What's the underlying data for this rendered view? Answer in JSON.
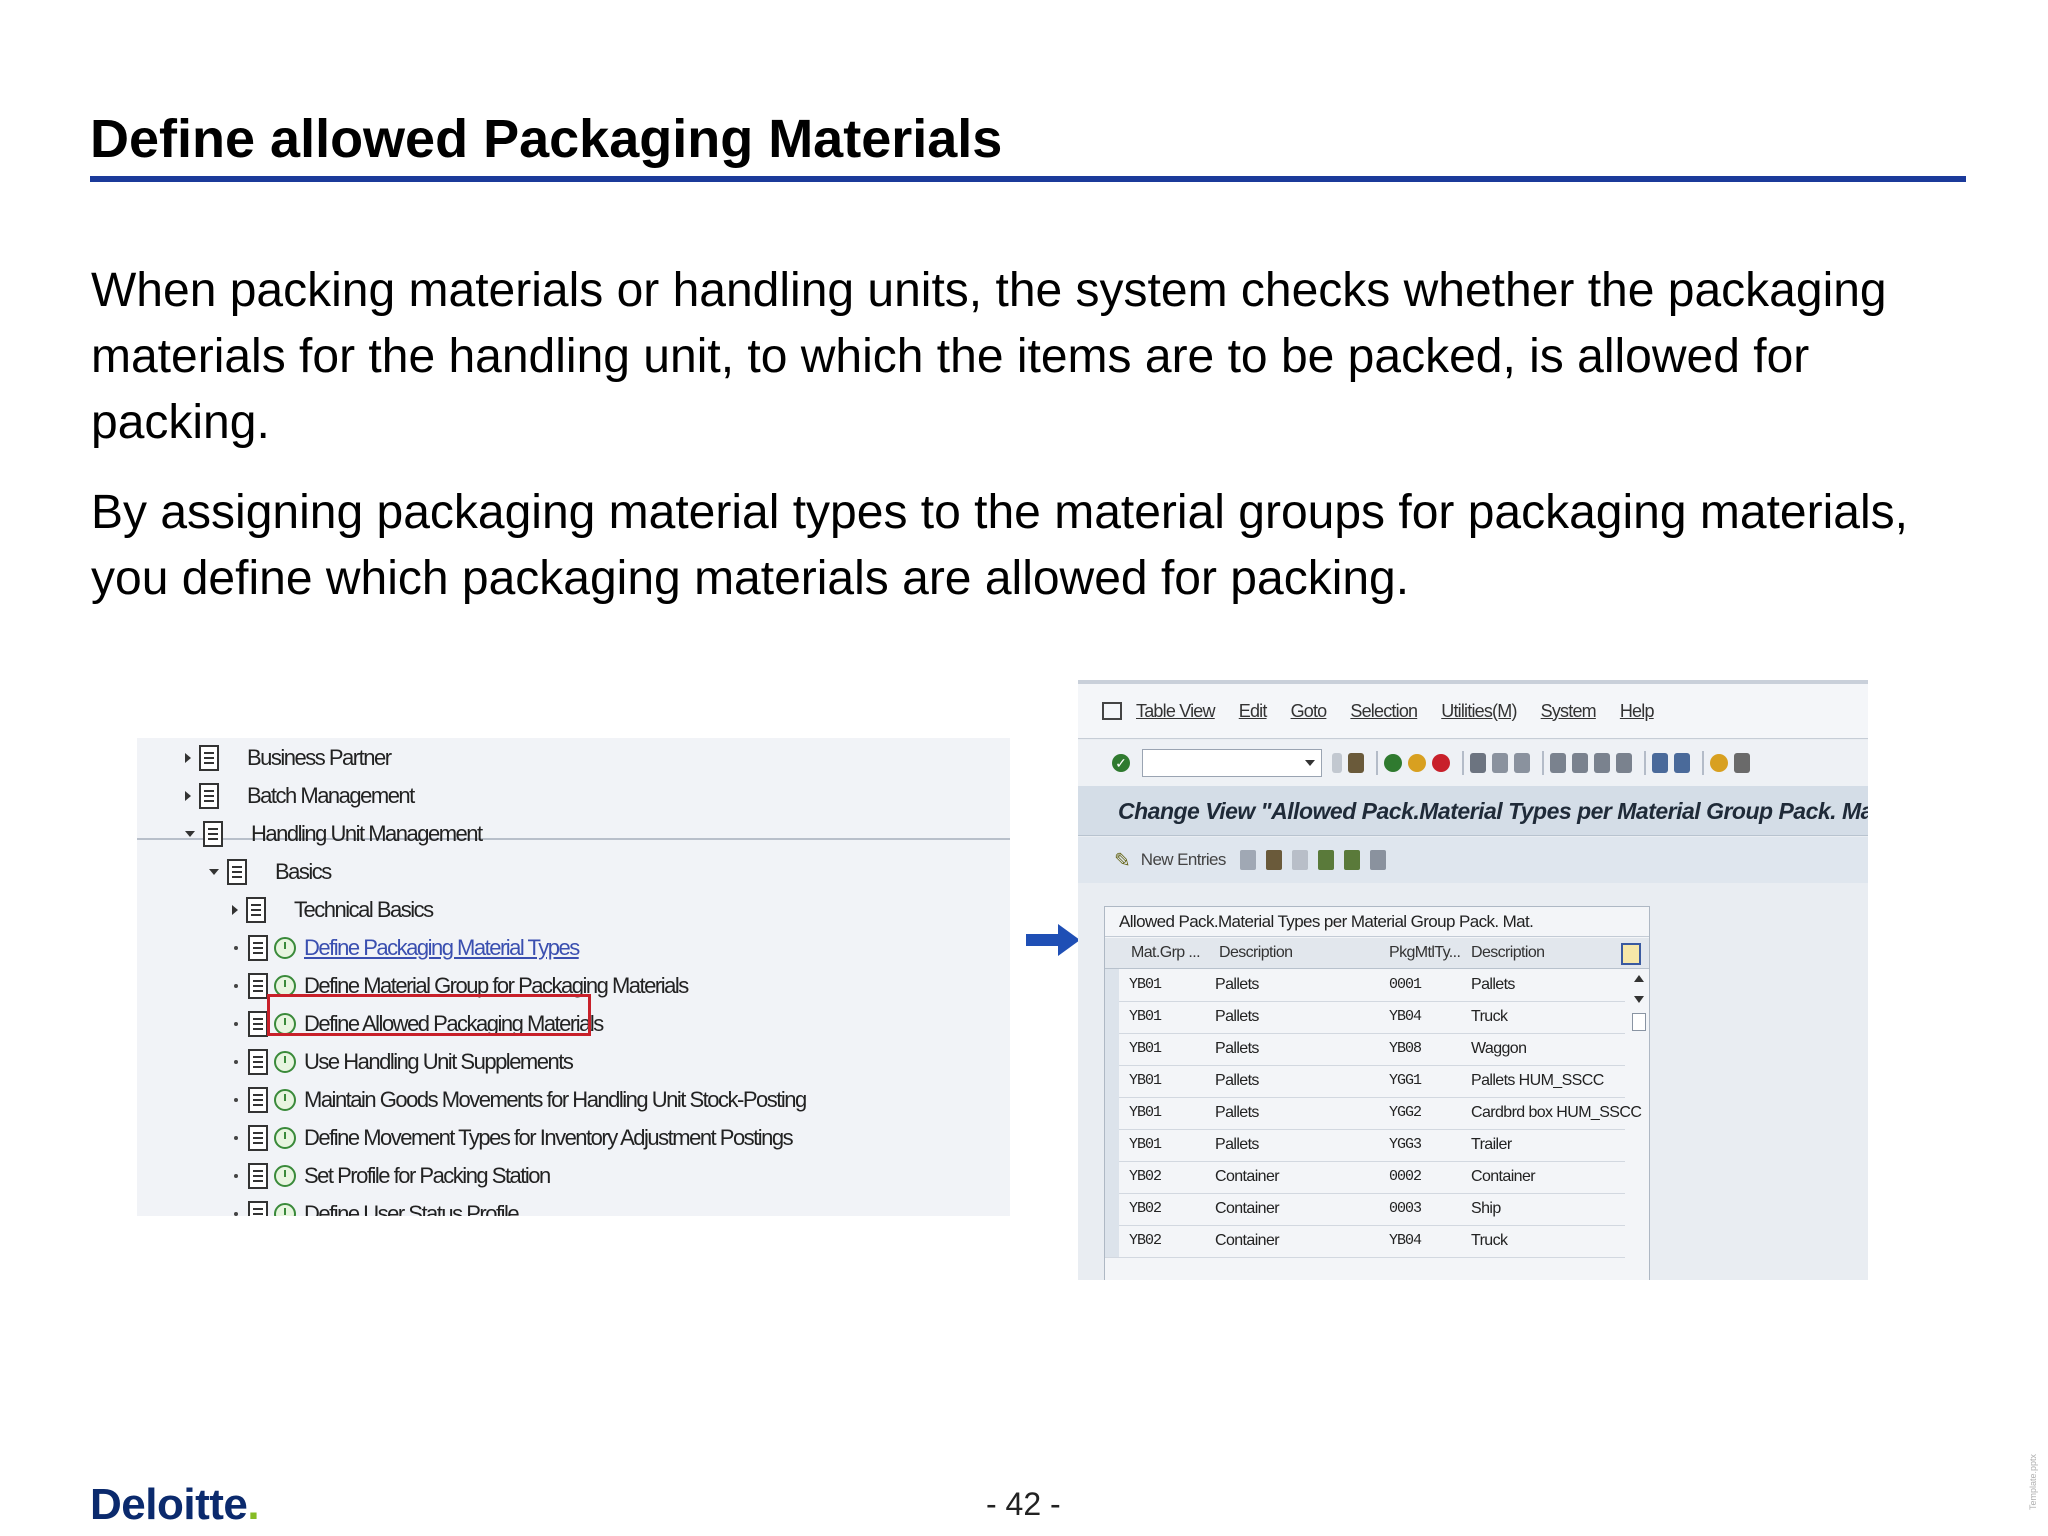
{
  "slide": {
    "title": "Define allowed Packaging Materials",
    "paragraph1": "When packing materials or handling units, the system checks whether the packaging materials for the handling unit, to which the items are to be packed, is allowed for packing.",
    "paragraph2": "By assigning packaging material types to the material groups for packaging materials, you define which packaging materials are allowed for packing.",
    "page_number": "- 42 -",
    "logo_text": "Deloitte",
    "logo_dot": ".",
    "side_note": "Template.pptx"
  },
  "tree": {
    "items": [
      {
        "label": "Business Partner"
      },
      {
        "label": "Batch Management"
      },
      {
        "label": "Handling Unit Management"
      },
      {
        "label": "Basics"
      },
      {
        "label": "Technical Basics"
      },
      {
        "label": "Define Packaging Material Types"
      },
      {
        "label": "Define Material Group for Packaging Materials"
      },
      {
        "label": "Define Allowed Packaging Materials"
      },
      {
        "label": "Use Handling Unit Supplements"
      },
      {
        "label": "Maintain Goods Movements for Handling Unit Stock-Posting"
      },
      {
        "label": "Define Movement Types for Inventory Adjustment Postings"
      },
      {
        "label": "Set Profile for Packing Station"
      },
      {
        "label": "Define User Status Profile"
      }
    ]
  },
  "sap": {
    "menu": [
      "Table View",
      "Edit",
      "Goto",
      "Selection",
      "Utilities(M)",
      "System",
      "Help"
    ],
    "screen_title": "Change View \"Allowed Pack.Material Types per Material Group Pack. Mat.",
    "new_entries_label": "New Entries",
    "table": {
      "caption": "Allowed Pack.Material Types per Material Group Pack. Mat.",
      "headers": [
        "Mat.Grp ...",
        "Description",
        "PkgMtlTy...",
        "Description"
      ],
      "rows": [
        [
          "YB01",
          "Pallets",
          "0001",
          "Pallets"
        ],
        [
          "YB01",
          "Pallets",
          "YB04",
          "Truck"
        ],
        [
          "YB01",
          "Pallets",
          "YB08",
          "Waggon"
        ],
        [
          "YB01",
          "Pallets",
          "YGG1",
          "Pallets HUM_SSCC"
        ],
        [
          "YB01",
          "Pallets",
          "YGG2",
          "Cardbrd box HUM_SSCC"
        ],
        [
          "YB01",
          "Pallets",
          "YGG3",
          "Trailer"
        ],
        [
          "YB02",
          "Container",
          "0002",
          "Container"
        ],
        [
          "YB02",
          "Container",
          "0003",
          "Ship"
        ],
        [
          "YB02",
          "Container",
          "YB04",
          "Truck"
        ]
      ]
    }
  }
}
